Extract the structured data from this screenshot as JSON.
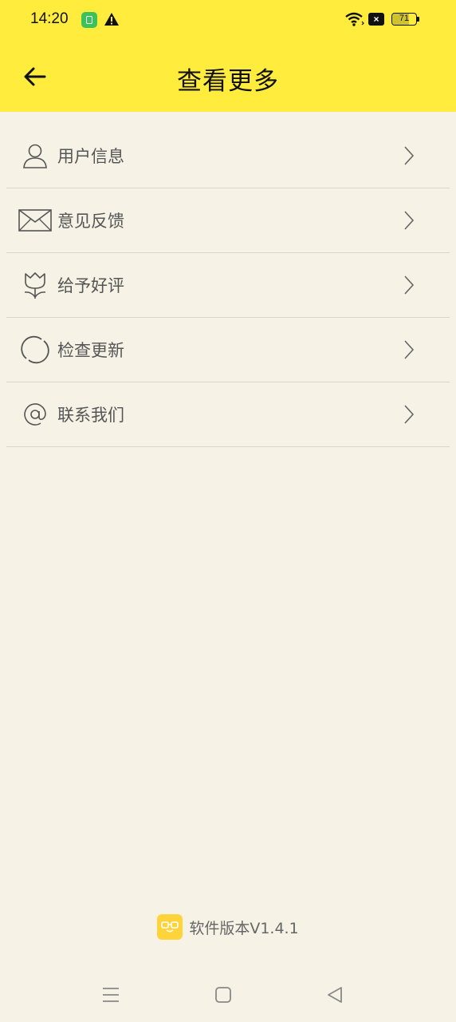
{
  "status_bar": {
    "time": "14:20",
    "battery_level": "71",
    "battery_fraction": 0.71
  },
  "header": {
    "title": "查看更多",
    "background_color": "#ffec3d"
  },
  "menu": {
    "items": [
      {
        "label": "用户信息",
        "icon": "user-icon"
      },
      {
        "label": "意见反馈",
        "icon": "envelope-icon"
      },
      {
        "label": "给予好评",
        "icon": "flower-icon"
      },
      {
        "label": "检查更新",
        "icon": "refresh-icon"
      },
      {
        "label": "联系我们",
        "icon": "at-sign-icon"
      }
    ]
  },
  "footer": {
    "version_text": "软件版本V1.4.1"
  },
  "colors": {
    "page_background": "#f6f3e6",
    "accent": "#ffec3d",
    "logo": "#ffd43b"
  }
}
